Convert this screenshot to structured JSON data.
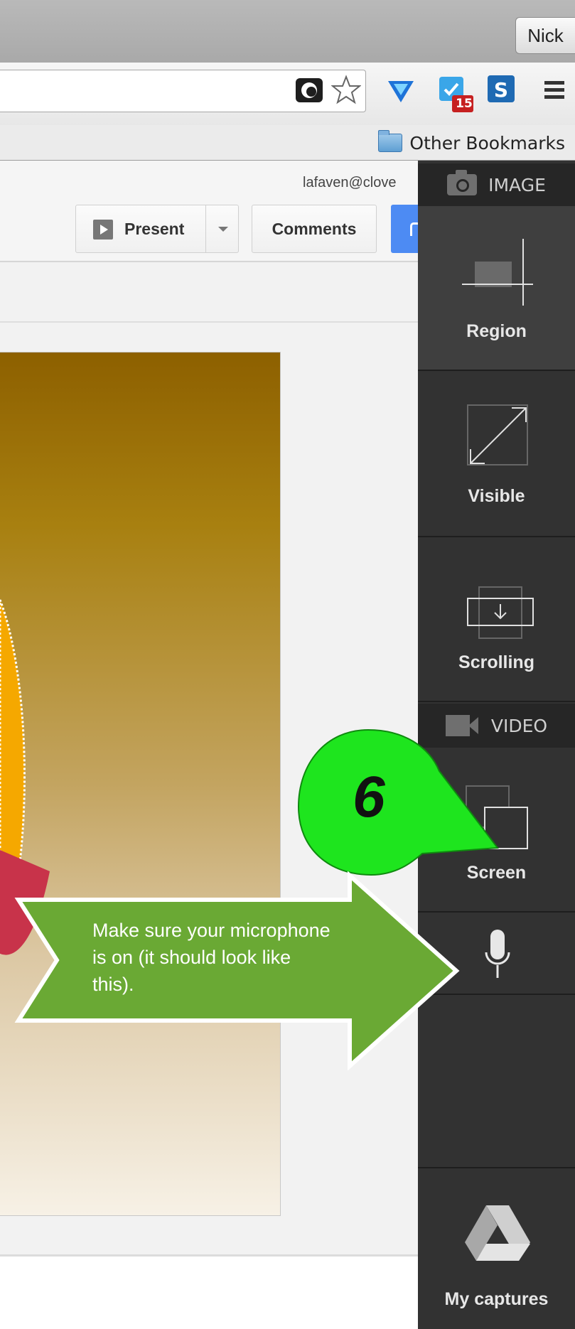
{
  "browser": {
    "profile_name": "Nick",
    "bookmarks_folder": "Other Bookmarks",
    "extension_badge": "15"
  },
  "document": {
    "user_email": "lafaven@clove",
    "present_label": "Present",
    "comments_label": "Comments"
  },
  "capture_panel": {
    "image_section_label": "IMAGE",
    "image_items": [
      {
        "label": "Region",
        "icon": "region-icon"
      },
      {
        "label": "Visible",
        "icon": "visible-icon"
      },
      {
        "label": "Scrolling",
        "icon": "scrolling-icon"
      }
    ],
    "video_section_label": "VIDEO",
    "video_items": [
      {
        "label": "Screen",
        "icon": "screen-icon"
      }
    ],
    "microphone": {
      "icon": "microphone-icon",
      "state": "on"
    },
    "my_captures_label": "My captures"
  },
  "annotations": {
    "step_number": "6",
    "instruction": "Make sure your microphone is on (it should look like this).",
    "colors": {
      "step_callout": "#1ee51e",
      "arrow": "#6aa934"
    }
  }
}
